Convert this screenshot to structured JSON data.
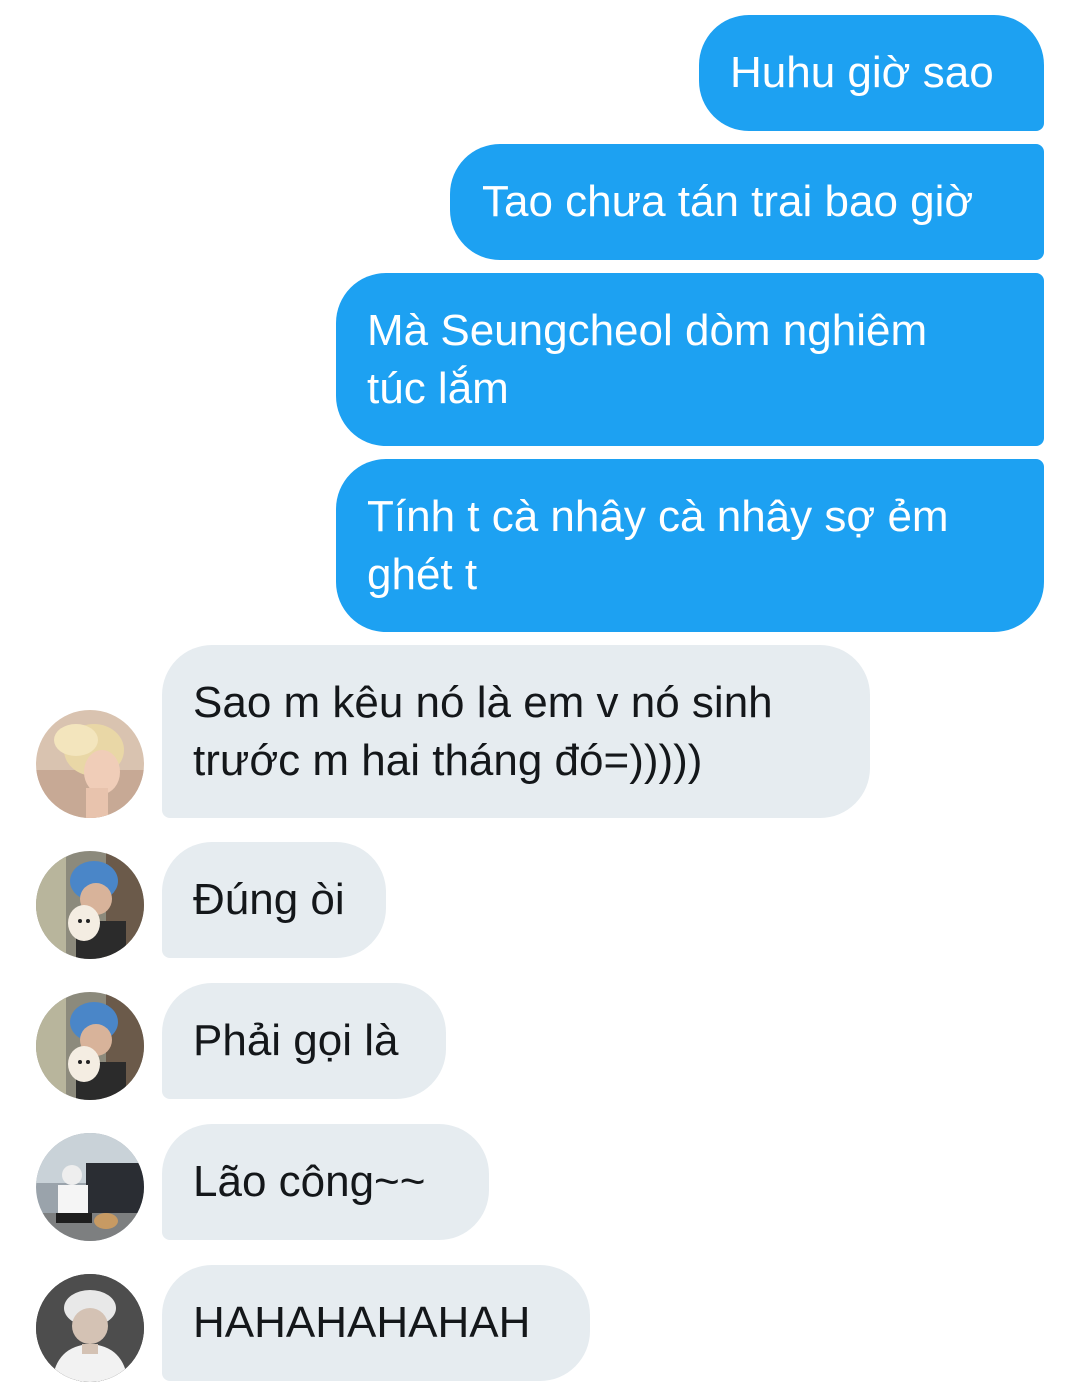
{
  "conversation": {
    "messages": [
      {
        "sender": "me",
        "text": "Huhu giờ sao"
      },
      {
        "sender": "me",
        "text": "Tao chưa tán trai bao giờ"
      },
      {
        "sender": "me",
        "text": "Mà Seungcheol dòm nghiêm\ntúc lắm"
      },
      {
        "sender": "me",
        "text": "Tính t cà nhây cà nhây sợ ẻm\nghét t"
      },
      {
        "sender": "other",
        "avatar": "blonde-profile-photo",
        "text": "Sao m kêu nó là em v nó sinh\ntrước m hai tháng đó=)))))"
      },
      {
        "sender": "other",
        "avatar": "blue-hair-dog-photo",
        "text": "Đúng òi"
      },
      {
        "sender": "other",
        "avatar": "blue-hair-dog-photo",
        "text": "Phải gọi là"
      },
      {
        "sender": "other",
        "avatar": "crouching-with-dog-photo",
        "text": "Lão công~~"
      },
      {
        "sender": "other",
        "avatar": "cap-hoodie-photo",
        "text": "HAHAHAHAHAH"
      }
    ]
  },
  "colors": {
    "sent_bubble": "#1da1f2",
    "received_bubble": "#e6ecf0",
    "received_text": "#14171a",
    "background": "#ffffff"
  }
}
